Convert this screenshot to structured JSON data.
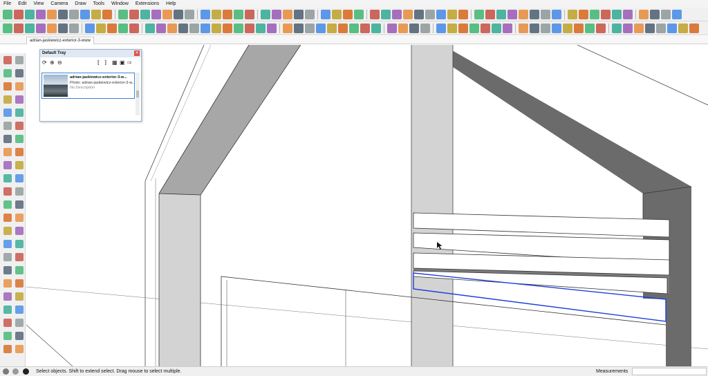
{
  "menu": [
    "File",
    "Edit",
    "View",
    "Camera",
    "Draw",
    "Tools",
    "Window",
    "Extensions",
    "Help"
  ],
  "document_tab": "adrian-jaskiewicz-exterior-3-www",
  "tray": {
    "title": "Default Tray",
    "close_glyph": "✕",
    "toolbar_icons": [
      "refresh-icon",
      "add-icon",
      "remove-icon",
      "expand-left-icon",
      "expand-right-icon",
      "view-options-icon",
      "project-icon",
      "forward-icon"
    ],
    "item": {
      "name": "adrian-jaskiewicz-exterior-3-w...",
      "photo": "Photo: adrian-jaskiewicz-exterior-3-w...",
      "description": "No Description"
    }
  },
  "status": {
    "hint": "Select objects. Shift to extend select. Drag mouse to select multiple.",
    "measurements_label": "Measurements",
    "measurements_value": ""
  },
  "colors": {
    "wall_dark": "#6b6b6b",
    "wall_mid": "#a7a7a7",
    "wall_light": "#d3d3d3",
    "selection": "#1f3fd8"
  }
}
